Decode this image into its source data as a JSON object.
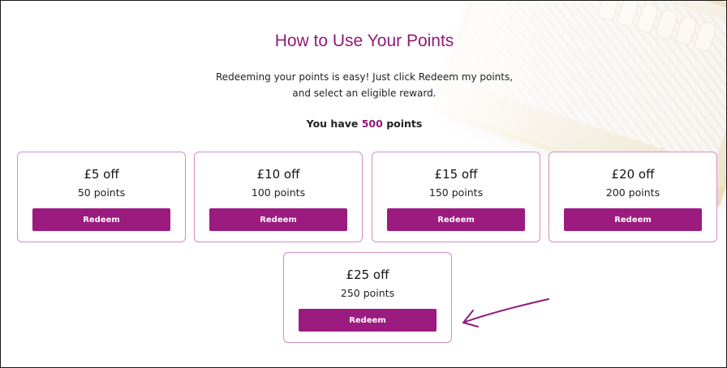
{
  "heading": "How to Use Your Points",
  "description_line1": "Redeeming your points is easy! Just click Redeem my points,",
  "description_line2": "and select an eligible reward.",
  "balance": {
    "prefix": "You have",
    "value": "500",
    "suffix": "points"
  },
  "rewards": [
    {
      "amount": "£5 off",
      "points": "50 points",
      "button": "Redeem"
    },
    {
      "amount": "£10 off",
      "points": "100 points",
      "button": "Redeem"
    },
    {
      "amount": "£15 off",
      "points": "150 points",
      "button": "Redeem"
    },
    {
      "amount": "£20 off",
      "points": "200 points",
      "button": "Redeem"
    },
    {
      "amount": "£25 off",
      "points": "250 points",
      "button": "Redeem"
    }
  ],
  "colors": {
    "accent": "#9b1b7f",
    "heading": "#8f1b7a",
    "card_border": "#d58bc8"
  },
  "icons": [
    "hand-drawn-arrow-icon"
  ]
}
